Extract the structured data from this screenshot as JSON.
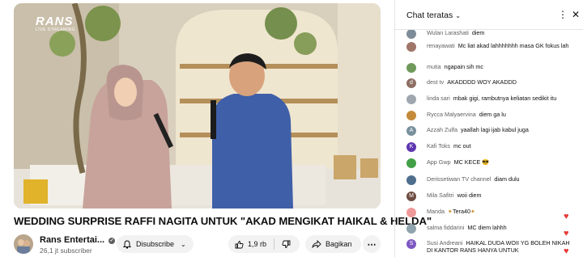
{
  "video": {
    "logo_text": "RANS",
    "logo_sub": "LIVE STREAMING"
  },
  "title": "WEDDING SURPRISE RAFFI NAGITA UNTUK \"AKAD MENGIKAT HAIKAL & HELDA\"",
  "channel": {
    "name": "Rans Entertai...",
    "subscribers": "26,1 jt subscriber"
  },
  "actions": {
    "subscribe_label": "Disubscribe",
    "like_count": "1,9 rb",
    "share_label": "Bagikan"
  },
  "chat": {
    "title": "Chat teratas",
    "messages": [
      {
        "author": "Wulan Larashati",
        "text": "diem",
        "initial": "",
        "color": "#7e8c99"
      },
      {
        "author": "renayawati",
        "text": "Mc liat akad lahhhhhhh masa GK fokus lah",
        "initial": "",
        "color": "#a0756a"
      },
      {
        "author": "mutia",
        "text": "ngapain sih mc",
        "initial": "",
        "color": "#6f9a5b"
      },
      {
        "author": "dest tv",
        "text": "AKADDDD WOY AKADDD",
        "initial": "d",
        "color": "#8d6e63"
      },
      {
        "author": "linda sari",
        "text": "mbak gigi, rambutnya keliatan sedikit itu",
        "initial": "",
        "color": "#9fa8b1"
      },
      {
        "author": "Rycca Malyaervina",
        "text": "diem ga lu",
        "initial": "",
        "color": "#c48a3a"
      },
      {
        "author": "Azzah Zulfa",
        "text": "yaallah lagi ijab kabul juga",
        "initial": "A",
        "color": "#78909c"
      },
      {
        "author": "Kafi Toks",
        "text": "mc out",
        "initial": "K",
        "color": "#5e35b1"
      },
      {
        "author": "App Gwp",
        "text": "MC KECE",
        "initial": "",
        "color": "#43a047"
      },
      {
        "author": "Derissetiwan TV channel",
        "text": "diam dulu",
        "initial": "",
        "color": "#4e6e8e"
      },
      {
        "author": "Mila Safitri",
        "text": "woii diem",
        "initial": "M",
        "color": "#6d4c41"
      },
      {
        "author": "Manda",
        "text": "Tera40",
        "initial": "",
        "color": "#ef9a9a"
      },
      {
        "author": "salma fiddarini",
        "text": "MC diem lahhh",
        "initial": "",
        "color": "#90a4ae"
      },
      {
        "author": "Susi Andreani",
        "text": "HAIKAL DUDA WOII YG BOLEH NIKAH DI KANTOR RANS HANYA UNTUK",
        "initial": "S",
        "color": "#7e57c2"
      }
    ]
  }
}
